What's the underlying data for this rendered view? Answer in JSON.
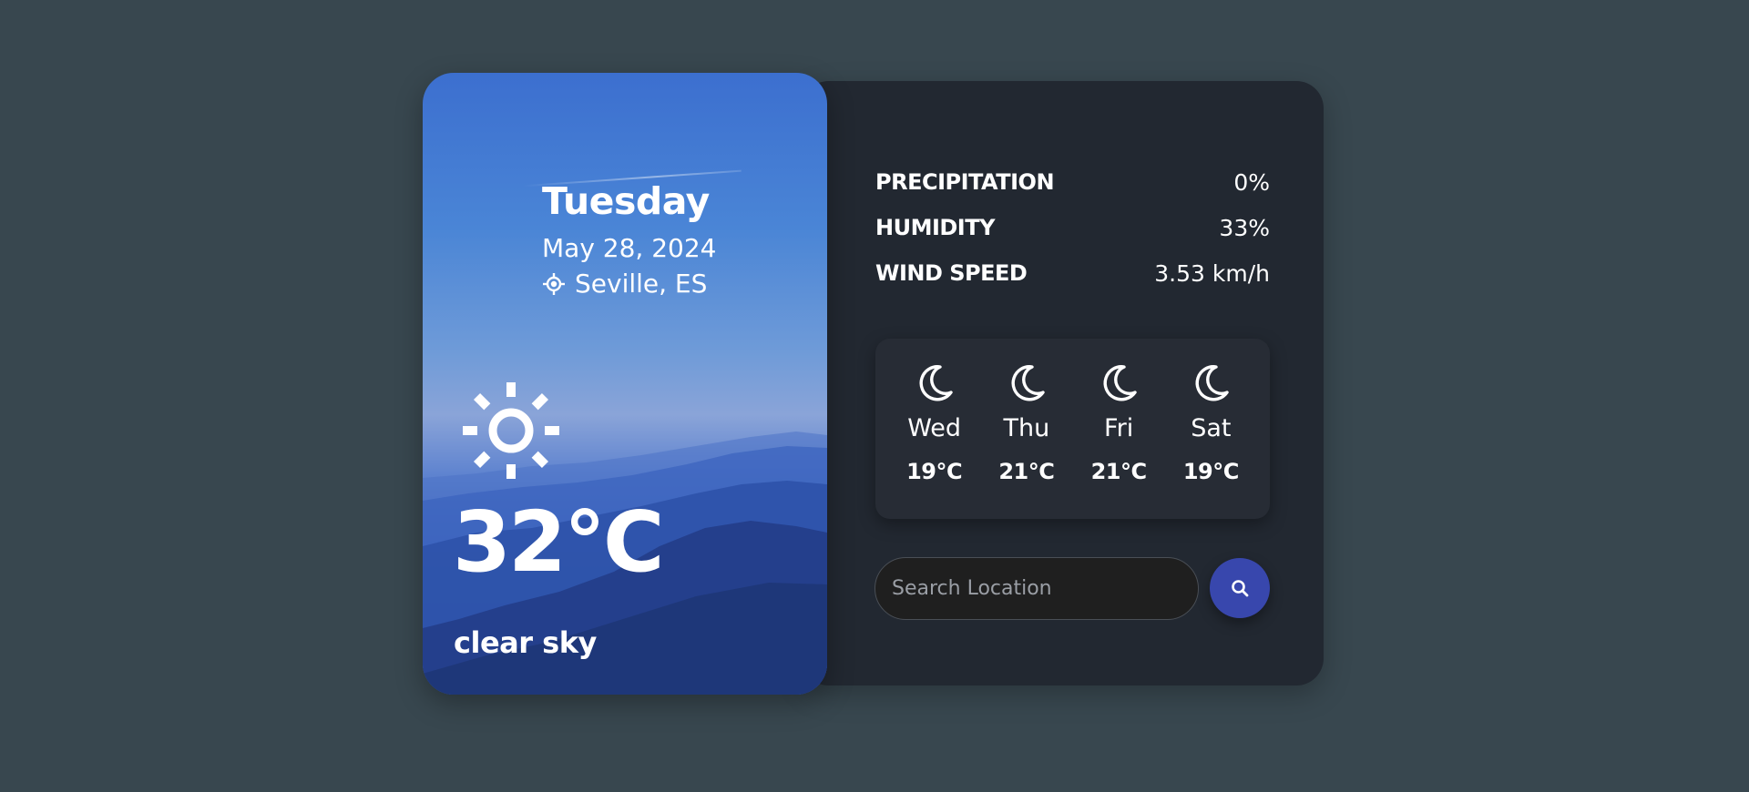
{
  "current": {
    "day": "Tuesday",
    "date": "May 28, 2024",
    "location": "Seville, ES",
    "temperature": "32°C",
    "condition": "clear sky",
    "icon": "sun-icon"
  },
  "stats": [
    {
      "label": "PRECIPITATION",
      "value": "0%"
    },
    {
      "label": "HUMIDITY",
      "value": "33%"
    },
    {
      "label": "WIND SPEED",
      "value": "3.53 km/h"
    }
  ],
  "forecast": [
    {
      "day": "Wed",
      "temp": "19°C",
      "icon": "moon-icon"
    },
    {
      "day": "Thu",
      "temp": "21°C",
      "icon": "moon-icon"
    },
    {
      "day": "Fri",
      "temp": "21°C",
      "icon": "moon-icon"
    },
    {
      "day": "Sat",
      "temp": "19°C",
      "icon": "moon-icon"
    }
  ],
  "search": {
    "placeholder": "Search Location",
    "value": ""
  },
  "colors": {
    "page_background": "#38474f",
    "panel_background": "#222831",
    "forecast_background": "#272c35",
    "search_button": "#3847ad",
    "card_gradient_top": "#3c6fcf",
    "card_gradient_bottom": "#243f93"
  }
}
